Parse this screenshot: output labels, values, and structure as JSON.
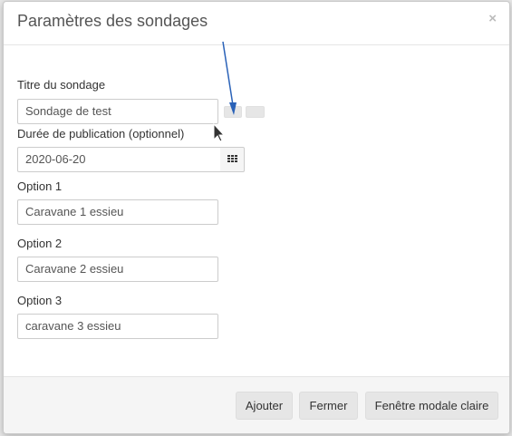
{
  "modal": {
    "title": "Paramètres des sondages",
    "close_symbol": "×"
  },
  "form": {
    "title_label": "Titre du sondage",
    "title_value": "Sondage de test",
    "duration_label": "Durée de publication (optionnel)",
    "duration_value": "2020-06-20",
    "options": [
      {
        "label": "Option 1",
        "value": "Caravane 1 essieu"
      },
      {
        "label": "Option 2",
        "value": "Caravane 2 essieu"
      },
      {
        "label": "Option 3",
        "value": "caravane 3 essieu"
      }
    ]
  },
  "footer": {
    "add_label": "Ajouter",
    "close_label": "Fermer",
    "light_modal_label": "Fenêtre modale claire"
  },
  "icons": {
    "calendar": "calendar-icon",
    "close": "close-icon",
    "cursor": "mouse-cursor-icon",
    "arrow": "annotation-arrow"
  },
  "colors": {
    "annotation_arrow": "#2a62b8",
    "footer_bg": "#f5f5f5",
    "button_bg": "#e6e6e6"
  }
}
